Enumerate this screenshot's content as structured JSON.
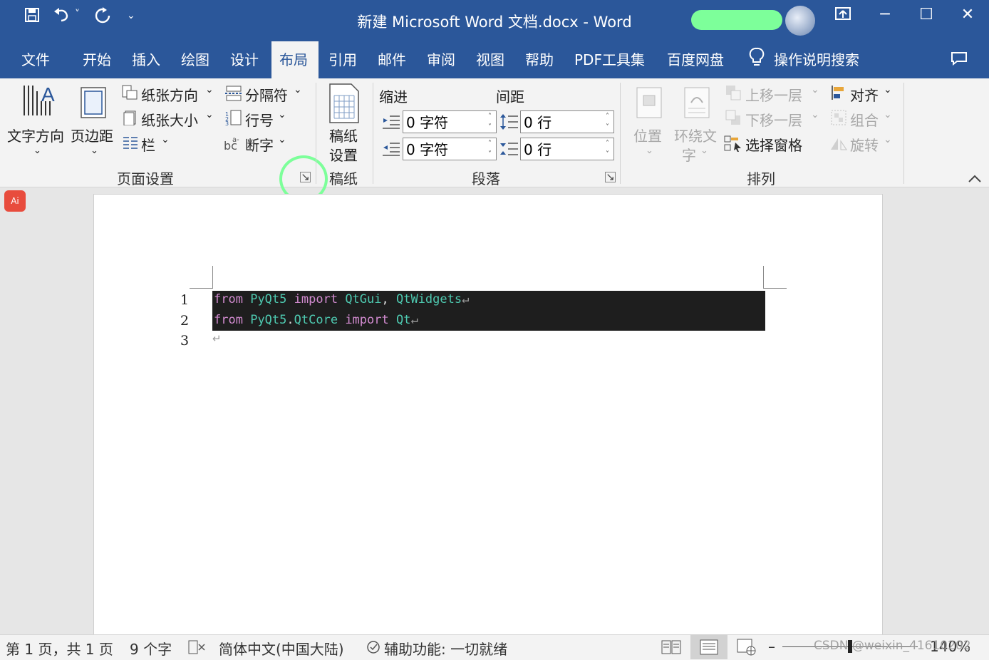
{
  "title": "新建 Microsoft Word 文档.docx  -  Word",
  "quick_access": {
    "save_icon": "save-icon",
    "undo_icon": "undo-icon",
    "undo_menu": "˅",
    "redo_icon": "redo-icon",
    "customize": "⌄"
  },
  "window": {
    "ribbon_display": "ribbon-display-icon",
    "minimize": "─",
    "maximize": "☐",
    "close": "✕"
  },
  "tabs": [
    "文件",
    "开始",
    "插入",
    "绘图",
    "设计",
    "布局",
    "引用",
    "邮件",
    "审阅",
    "视图",
    "帮助",
    "PDF工具集",
    "百度网盘"
  ],
  "active_tab": "布局",
  "tell_me": "操作说明搜索",
  "page_setup": {
    "text_direction": "文字方向",
    "margins": "页边距",
    "orientation": "纸张方向",
    "size": "纸张大小",
    "columns": "栏",
    "breaks": "分隔符",
    "line_numbers": "行号",
    "hyphenation": "断字",
    "group": "页面设置"
  },
  "manuscript": {
    "button_line1": "稿纸",
    "button_line2": "设置",
    "group": "稿纸"
  },
  "paragraph": {
    "indent_label": "缩进",
    "spacing_label": "间距",
    "indent_left": "0 字符",
    "indent_right": "0 字符",
    "space_before": "0 行",
    "space_after": "0 行",
    "group": "段落"
  },
  "arrange": {
    "position": "位置",
    "wrap_text_1": "环绕文",
    "wrap_text_2": "字",
    "bring_forward": "上移一层",
    "send_backward": "下移一层",
    "selection_pane": "选择窗格",
    "align": "对齐",
    "group_objects": "组合",
    "rotate": "旋转",
    "group": "排列"
  },
  "document": {
    "line_numbers": [
      "1",
      "2",
      "3"
    ],
    "code_lines": [
      [
        {
          "t": "from",
          "c": "kw"
        },
        {
          "t": " ",
          "c": "pl"
        },
        {
          "t": "PyQt5",
          "c": "mod"
        },
        {
          "t": " ",
          "c": "pl"
        },
        {
          "t": "import",
          "c": "kw"
        },
        {
          "t": " ",
          "c": "pl"
        },
        {
          "t": "QtGui",
          "c": "mod"
        },
        {
          "t": ", ",
          "c": "pl"
        },
        {
          "t": "QtWidgets",
          "c": "mod"
        },
        {
          "t": "↵",
          "c": "mark"
        }
      ],
      [
        {
          "t": "from",
          "c": "kw"
        },
        {
          "t": " ",
          "c": "pl"
        },
        {
          "t": "PyQt5",
          "c": "mod"
        },
        {
          "t": ".",
          "c": "pl"
        },
        {
          "t": "QtCore",
          "c": "mod"
        },
        {
          "t": " ",
          "c": "pl"
        },
        {
          "t": "import",
          "c": "kw"
        },
        {
          "t": " ",
          "c": "pl"
        },
        {
          "t": "Qt",
          "c": "mod"
        },
        {
          "t": "↵",
          "c": "mark"
        }
      ]
    ],
    "empty_line_mark": "↵"
  },
  "status": {
    "page": "第 1 页，共 1 页",
    "words": "9 个字",
    "language": "简体中文(中国大陆)",
    "accessibility": "辅助功能: 一切就绪",
    "zoom_minus": "–",
    "zoom": "140%",
    "watermark": "CSDN @weixin_41610202"
  },
  "ai_badge": "Ai",
  "colors": {
    "accent": "#2b579a",
    "highlight_circle": "#7dff9a",
    "code_bg": "#1e1e1e",
    "keyword": "#d28bd0",
    "module": "#4ec9b0"
  }
}
